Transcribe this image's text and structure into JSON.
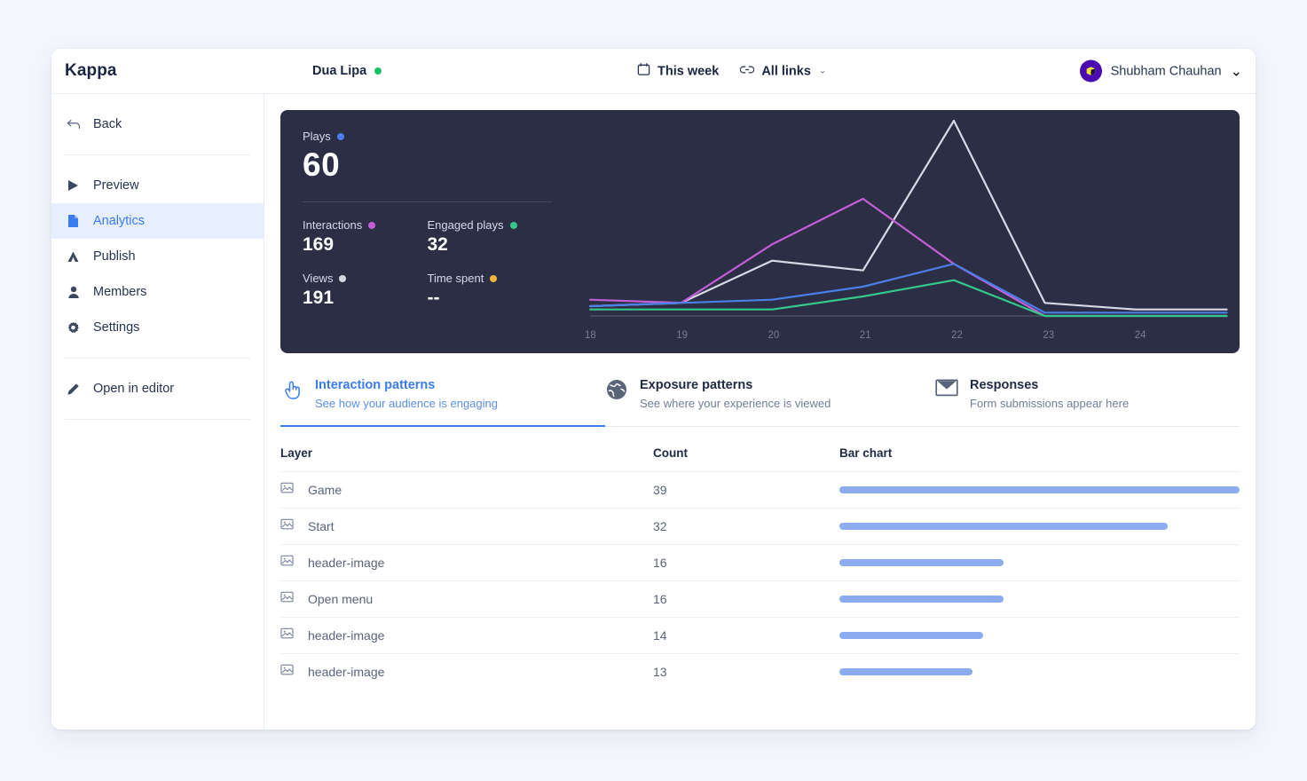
{
  "topbar": {
    "brand": "Kappa",
    "project_name": "Dua Lipa",
    "status_dot": "green-status-dot",
    "filters": [
      {
        "icon": "calendar-icon",
        "label": "This week",
        "has_chevron": false
      },
      {
        "icon": "link-icon",
        "label": "All links",
        "has_chevron": true,
        "chevron": "⌄"
      }
    ],
    "user": {
      "name": "Shubham Chauhan",
      "chevron": "⌄",
      "avatar_icon": "cube-avatar",
      "avatar_bg": "#4b0bb0",
      "avatar_fg": "#f5e33c"
    }
  },
  "sidebar": {
    "back": {
      "label": "Back",
      "icon": "back-arrow-icon"
    },
    "items": [
      {
        "label": "Preview",
        "icon": "play-icon",
        "active": false
      },
      {
        "label": "Analytics",
        "icon": "document-icon",
        "active": true
      },
      {
        "label": "Publish",
        "icon": "publish-up-icon",
        "active": false
      },
      {
        "label": "Members",
        "icon": "person-icon",
        "active": false
      },
      {
        "label": "Settings",
        "icon": "gear-icon",
        "active": false
      }
    ],
    "editor": {
      "label": "Open in editor",
      "icon": "pencil-icon"
    }
  },
  "stats": [
    {
      "label": "Plays",
      "value": "60",
      "color": "#4a7fe8",
      "big": true
    },
    {
      "label": "Interactions",
      "value": "169",
      "color": "#c45ed6",
      "big": false
    },
    {
      "label": "Engaged plays",
      "value": "32",
      "color": "#35c88a",
      "big": false
    },
    {
      "label": "Views",
      "value": "191",
      "color": "#d7dae6",
      "big": false
    },
    {
      "label": "Time spent",
      "value": "--",
      "color": "#f0b73e",
      "big": false
    }
  ],
  "chart_data": {
    "type": "line",
    "title": "",
    "xlabel": "",
    "ylabel": "",
    "categories": [
      "18",
      "19",
      "20",
      "21",
      "22",
      "23",
      "24"
    ],
    "x_tick_labels": [
      "18",
      "19",
      "20",
      "21",
      "22",
      "23",
      "24"
    ],
    "xlim": [
      18,
      25
    ],
    "ylim": [
      0,
      60
    ],
    "grid": false,
    "legend_position": "left-panel",
    "series": [
      {
        "name": "Views",
        "color": "#d7dae6",
        "values": [
          3,
          4,
          17,
          14,
          60,
          4,
          2,
          2
        ]
      },
      {
        "name": "Interactions",
        "color": "#c45ed6",
        "values": [
          5,
          4,
          22,
          36,
          16,
          0,
          0,
          0
        ]
      },
      {
        "name": "Plays",
        "color": "#4a7fe8",
        "values": [
          3,
          4,
          5,
          9,
          16,
          1,
          1,
          1
        ]
      },
      {
        "name": "Engaged plays",
        "color": "#35c88a",
        "values": [
          2,
          2,
          2,
          6,
          11,
          0,
          0,
          0
        ]
      }
    ]
  },
  "tabs": [
    {
      "icon": "pointing-hand-icon",
      "title": "Interaction patterns",
      "subtitle": "See how your audience is engaging",
      "active": true
    },
    {
      "icon": "globe-icon",
      "title": "Exposure patterns",
      "subtitle": "See where your experience is viewed",
      "active": false
    },
    {
      "icon": "envelope-icon",
      "title": "Responses",
      "subtitle": "Form submissions appear here",
      "active": false
    }
  ],
  "table": {
    "columns": [
      "Layer",
      "Count",
      "Bar chart"
    ],
    "max_count": 39,
    "rows": [
      {
        "icon": "image-icon",
        "layer": "Game",
        "count": "39"
      },
      {
        "icon": "image-icon",
        "layer": "Start",
        "count": "32"
      },
      {
        "icon": "image-icon",
        "layer": "header-image",
        "count": "16"
      },
      {
        "icon": "image-icon",
        "layer": "Open menu",
        "count": "16"
      },
      {
        "icon": "image-icon",
        "layer": "header-image",
        "count": "14"
      },
      {
        "icon": "image-icon",
        "layer": "header-image",
        "count": "13"
      }
    ]
  },
  "colors": {
    "accent": "#3b7cf0",
    "bar": "#8cabf0",
    "hero_bg": "#2b2e45",
    "page_bg": "#f3f6fc"
  }
}
